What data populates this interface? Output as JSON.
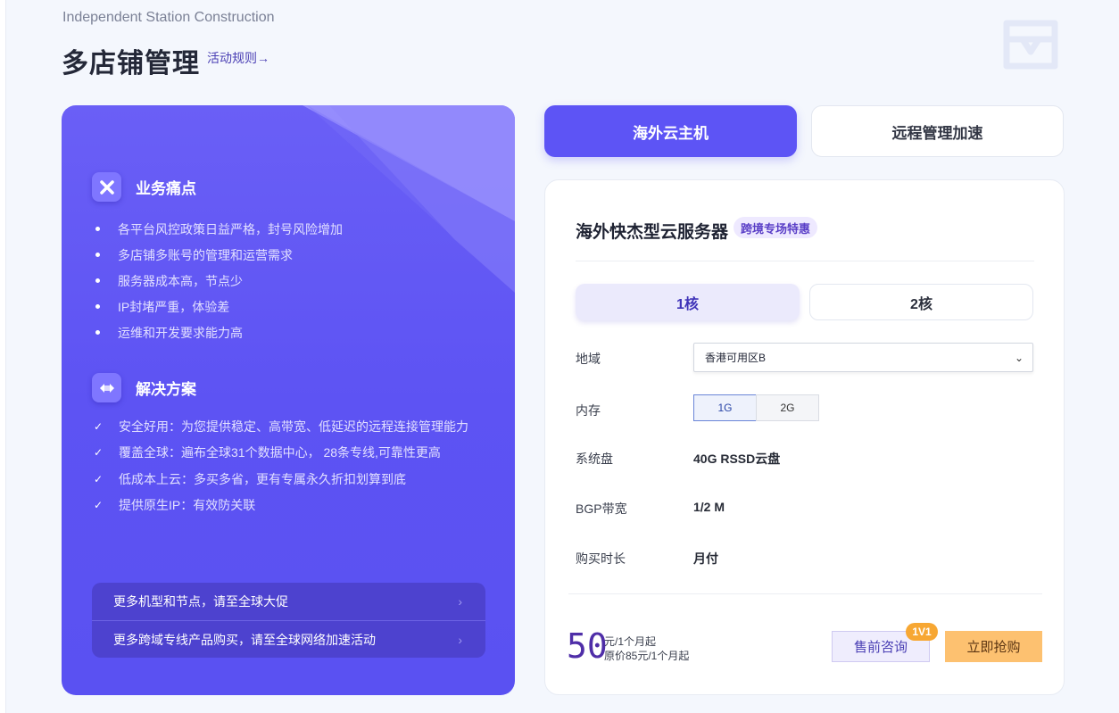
{
  "header": {
    "subtitle": "Independent Station Construction",
    "title": "多店铺管理",
    "rules_link": "活动规则→"
  },
  "left_panel": {
    "pain_title": "业务痛点",
    "pain_points": [
      "各平台风控政策日益严格，封号风险增加",
      "多店铺多账号的管理和运营需求",
      "服务器成本高，节点少",
      "IP封堵严重，体验差",
      "运维和开发要求能力高"
    ],
    "solution_title": "解决方案",
    "solutions": [
      "安全好用：为您提供稳定、高带宽、低延迟的远程连接管理能力",
      "覆盖全球：遍布全球31个数据中心， 28条专线,可靠性更高",
      "低成本上云：多买多省，更有专属永久折扣划算到底",
      "提供原生IP：有效防关联"
    ],
    "promo_links": [
      "更多机型和节点，请至全球大促",
      "更多跨域专线产品购买，请至全球网络加速活动"
    ],
    "arrow": "›"
  },
  "tabs": {
    "active": "海外云主机",
    "inactive": "远程管理加速"
  },
  "card": {
    "product_title": "海外快杰型云服务器",
    "product_badge": "跨境专场特惠",
    "cores": {
      "active": "1核",
      "inactive": "2核"
    },
    "region": {
      "label": "地域",
      "value": "香港可用区B",
      "chevron": "⌄"
    },
    "memory": {
      "label": "内存",
      "active": "1G",
      "inactive": "2G"
    },
    "disk": {
      "label": "系统盘",
      "value": "40G RSSD云盘"
    },
    "bandwidth": {
      "label": "BGP带宽",
      "value": "1/2 M"
    },
    "duration": {
      "label": "购买时长",
      "value": "月付"
    },
    "price": {
      "amount": "50",
      "unit": "元/1个月起",
      "original": "原价85元/1个月起"
    },
    "consult_button": "售前咨询",
    "consult_badge": "1V1",
    "buy_button": "立即抢购"
  },
  "colors": {
    "accent": "#5d54f5",
    "panel": "#5d53f3",
    "buy": "#fdc170",
    "badge": "#f7a733"
  },
  "icons": {
    "pain_icon": "x-icon",
    "solution_icon": "diamond-arrows-icon",
    "check_icon": "checkmark-icon",
    "logo": "brand-logo-icon"
  }
}
